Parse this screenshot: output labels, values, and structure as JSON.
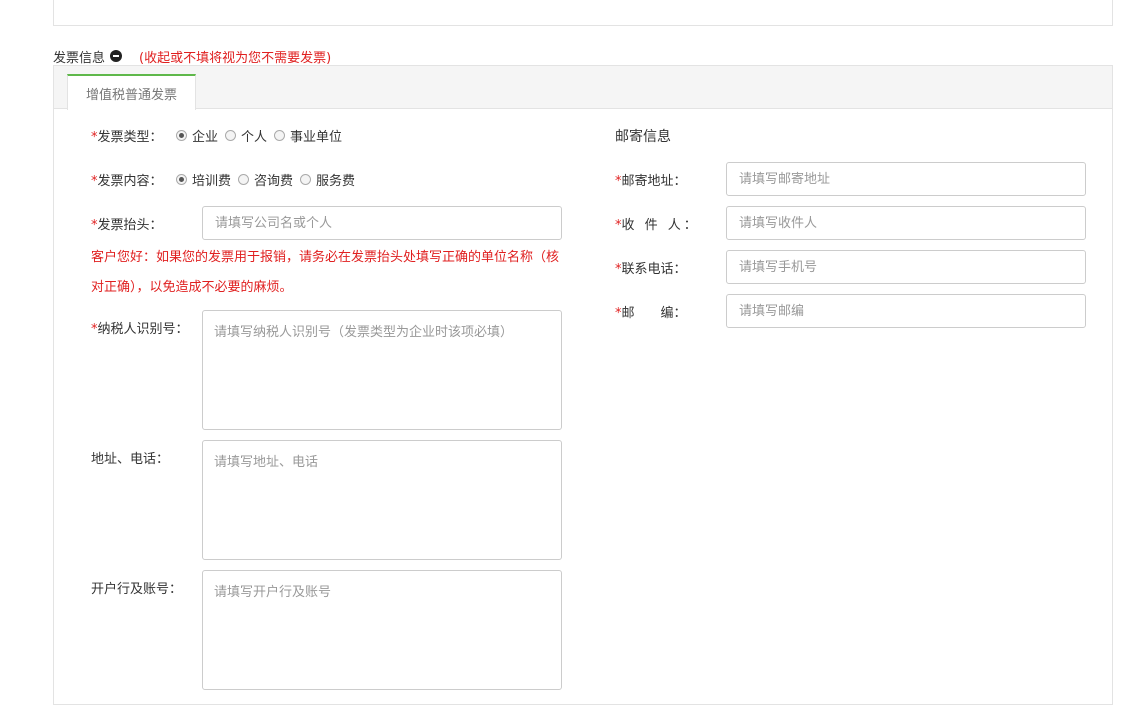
{
  "section": {
    "title": "发票信息",
    "hint": "(收起或不填将视为您不需要发票)"
  },
  "tab": {
    "label": "增值税普通发票"
  },
  "invoice": {
    "type": {
      "label": "发票类型：",
      "options": [
        "企业",
        "个人",
        "事业单位"
      ],
      "selected": "企业"
    },
    "content": {
      "label": "发票内容：",
      "options": [
        "培训费",
        "咨询费",
        "服务费"
      ],
      "selected": "培训费"
    },
    "header": {
      "label": "发票抬头：",
      "placeholder": "请填写公司名或个人"
    },
    "notice": "客户您好：如果您的发票用于报销，请务必在发票抬头处填写正确的单位名称（核对正确），以免造成不必要的麻烦。",
    "tax_id": {
      "label": "纳税人识别号：",
      "placeholder": "请填写纳税人识别号（发票类型为企业时该项必填）"
    },
    "address_phone": {
      "label": "地址、电话：",
      "placeholder": "请填写地址、电话"
    },
    "bank_account": {
      "label": "开户行及账号：",
      "placeholder": "请填写开户行及账号"
    }
  },
  "mailing": {
    "title": "邮寄信息",
    "address": {
      "label": "邮寄地址：",
      "placeholder": "请填写邮寄地址"
    },
    "recipient": {
      "label": "收 件 人：",
      "placeholder": "请填写收件人"
    },
    "phone": {
      "label": "联系电话：",
      "placeholder": "请填写手机号"
    },
    "postcode": {
      "label": "邮　　编：",
      "placeholder": "请填写邮编"
    }
  },
  "required_mark": "*"
}
